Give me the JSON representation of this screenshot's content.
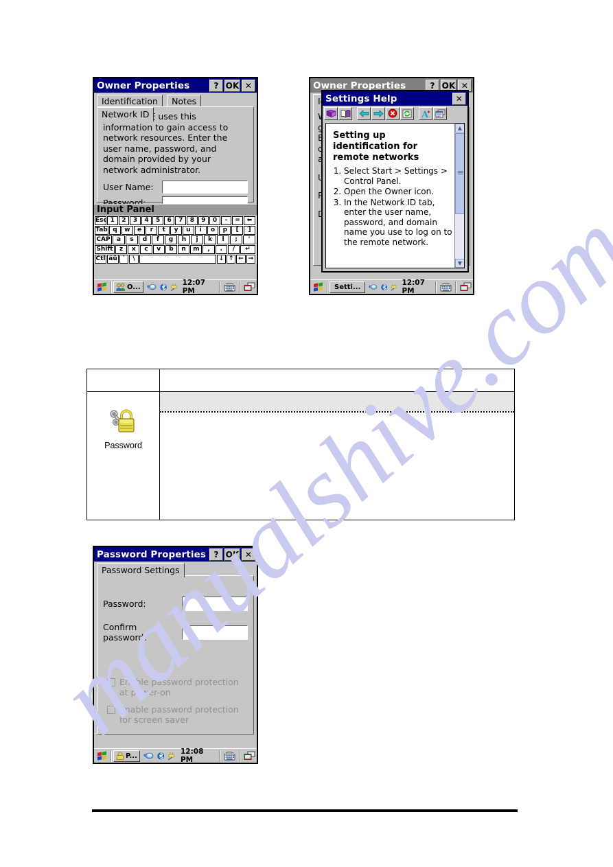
{
  "page": {
    "watermark": "manualshive.com"
  },
  "owner_window": {
    "title": "Owner Properties",
    "buttons": {
      "help": "?",
      "ok": "OK",
      "close": "✕"
    },
    "tabs": [
      {
        "label": "Identification",
        "selected": false
      },
      {
        "label": "Notes",
        "selected": false
      },
      {
        "label": "Network ID",
        "selected": true
      }
    ],
    "description": "Windows CE uses this information to gain access to network resources. Enter the user name, password, and domain provided by your network administrator.",
    "fields": [
      {
        "label": "User Name:",
        "value": ""
      },
      {
        "label": "Password:",
        "value": ""
      }
    ],
    "input_panel": {
      "title": "Input Panel",
      "rows": [
        [
          "Esc",
          "1",
          "2",
          "3",
          "4",
          "5",
          "6",
          "7",
          "8",
          "9",
          "0",
          "-",
          "=",
          "⬅"
        ],
        [
          "Tab",
          "q",
          "w",
          "e",
          "r",
          "t",
          "y",
          "u",
          "i",
          "o",
          "p",
          "[",
          "]"
        ],
        [
          "CAP",
          "a",
          "s",
          "d",
          "f",
          "g",
          "h",
          "j",
          "k",
          "l",
          ";",
          "'"
        ],
        [
          "Shift",
          "z",
          "x",
          "c",
          "v",
          "b",
          "n",
          "m",
          ",",
          ".",
          "/",
          "↵"
        ],
        [
          "Ctl",
          "áü",
          "`",
          "\\",
          "",
          "↓",
          "↑",
          "←",
          "→"
        ]
      ]
    },
    "taskbar": {
      "task_label": "O...",
      "clock": "12:07 PM"
    }
  },
  "owner_window_2": {
    "title": "Owner Properties",
    "buttons": {
      "help": "?",
      "ok": "OK",
      "close": "✕"
    },
    "partial_tab": "Id",
    "obscured_letters": [
      "W",
      "g",
      "E",
      "c",
      "a",
      "U",
      "P",
      "D"
    ],
    "taskbar": {
      "task_label": "Setti...",
      "clock": "12:07 PM"
    }
  },
  "help_window": {
    "title": "Settings Help",
    "close": "✕",
    "toolbar_icons": [
      "contents-book-icon",
      "open-book-icon",
      "back-arrow-icon",
      "forward-arrow-icon",
      "stop-icon",
      "refresh-icon",
      "font-size-icon",
      "window-icon"
    ],
    "heading": "Setting up identification for remote networks",
    "steps": [
      "Select Start > Settings > Control Panel.",
      "Open the Owner icon.",
      "In the Network ID tab, enter the user name, password, and domain name you use to log on to the remote network."
    ]
  },
  "table": {
    "columns": [
      "",
      ""
    ],
    "header_row": [
      "",
      ""
    ],
    "rows": [
      {
        "icon_name": "password-lock-icon",
        "icon_caption": "Password",
        "content_shaded": "",
        "content_body": ""
      }
    ]
  },
  "password_window": {
    "title": "Password Properties",
    "buttons": {
      "help": "?",
      "ok": "OK",
      "close": "✕"
    },
    "tabs": [
      {
        "label": "Password Settings",
        "selected": true
      }
    ],
    "fields": [
      {
        "label": "Password:",
        "value": ""
      },
      {
        "label": "Confirm password:",
        "value": ""
      }
    ],
    "checkboxes": [
      {
        "label": "Enable password protection at power-on",
        "checked": false,
        "disabled": true
      },
      {
        "label": "Enable password protection for screen saver",
        "checked": false,
        "disabled": true
      }
    ],
    "taskbar": {
      "task_label": "P...",
      "clock": "12:08 PM"
    }
  },
  "colors": {
    "title_active": "#000080",
    "title_inactive": "#808080",
    "window_face": "#c6c6c6",
    "shade": "#e6e6e6",
    "watermark": "#c9caf0"
  }
}
